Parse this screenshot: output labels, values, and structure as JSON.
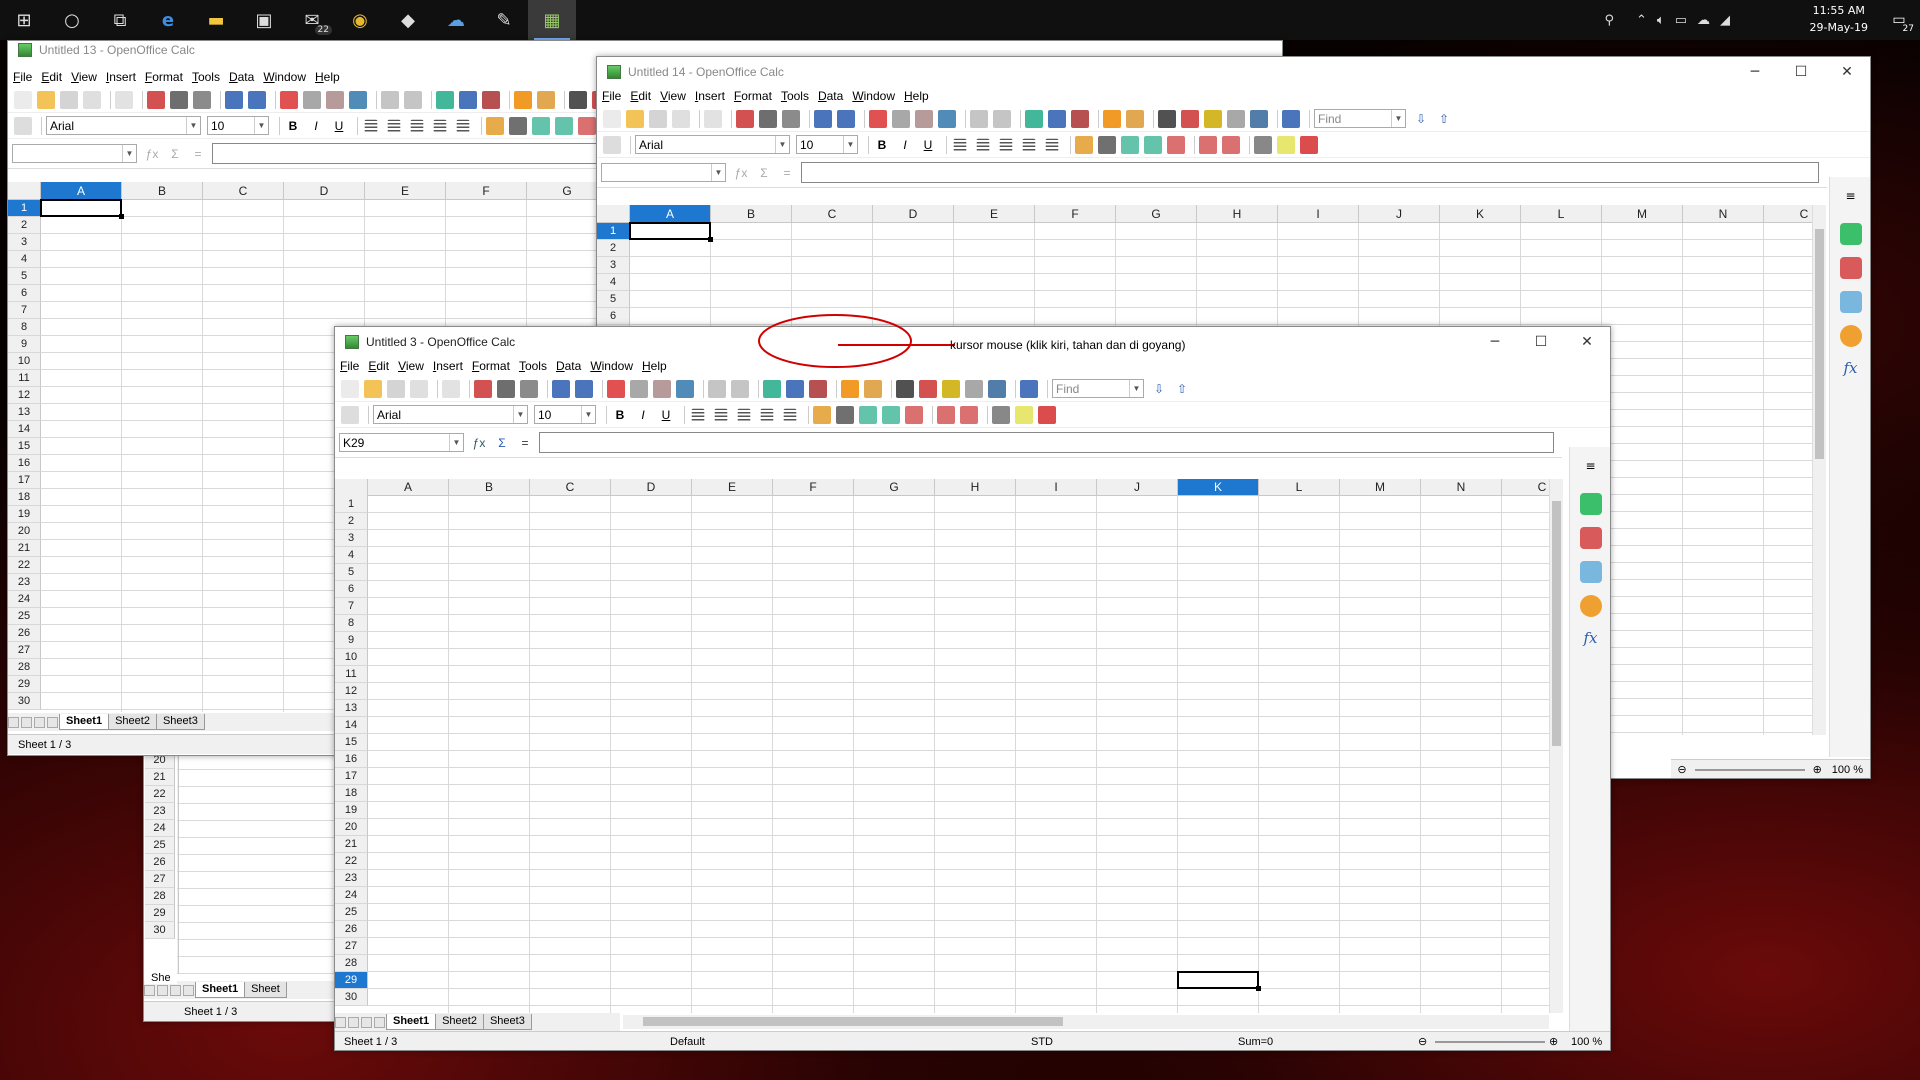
{
  "taskbar": {
    "mail_badge": "22",
    "clock_time": "11:55 AM",
    "clock_date": "29-May-19",
    "notification_count": "27"
  },
  "app_name": "OpenOffice Calc",
  "menu": [
    "File",
    "Edit",
    "View",
    "Insert",
    "Format",
    "Tools",
    "Data",
    "Window",
    "Help"
  ],
  "toolbar": {
    "font_name": "Arial",
    "font_size": "10",
    "find_placeholder": "Find",
    "bold": "B",
    "italic": "I",
    "underline": "U"
  },
  "window_13": {
    "title": "Untitled 13 - OpenOffice Calc",
    "columns": [
      "A",
      "B",
      "C",
      "D",
      "E",
      "F",
      "G"
    ],
    "selected_column": "A",
    "selected_row": "1",
    "tabs": [
      "Sheet1",
      "Sheet2",
      "Sheet3"
    ],
    "status": "Sheet 1 / 3"
  },
  "window_14": {
    "title": "Untitled 14 - OpenOffice Calc",
    "columns": [
      "A",
      "B",
      "C",
      "D",
      "E",
      "F",
      "G",
      "H",
      "I",
      "J",
      "K",
      "L",
      "M",
      "N",
      "C"
    ],
    "selected_column": "A",
    "selected_row": "1",
    "zoom": "100 %"
  },
  "window_back": {
    "rows": [
      "18",
      "19",
      "20",
      "21",
      "22",
      "23",
      "24",
      "25",
      "26",
      "27",
      "28",
      "29",
      "30"
    ],
    "rows_outer": [
      "20",
      "21",
      "22",
      "23",
      "24",
      "25",
      "26",
      "27",
      "28",
      "29",
      "30"
    ],
    "tabs": [
      "Sheet1",
      "Sheet"
    ],
    "status": "Sheet 1 / 3",
    "tab_stub": "She"
  },
  "window_3": {
    "title": "Untitled 3 - OpenOffice Calc",
    "name_box": "K29",
    "columns": [
      "A",
      "B",
      "C",
      "D",
      "E",
      "F",
      "G",
      "H",
      "I",
      "J",
      "K",
      "L",
      "M",
      "N",
      "C"
    ],
    "selected_column": "K",
    "selected_row": "29",
    "tabs": [
      "Sheet1",
      "Sheet2",
      "Sheet3"
    ],
    "status_sheet": "Sheet 1 / 3",
    "status_style": "Default",
    "status_mode": "STD",
    "status_sum": "Sum=0",
    "zoom": "100 %"
  },
  "annotation": {
    "text": "kursor mouse (klik kiri, tahan dan di goyang)",
    "color": "#d00000"
  }
}
